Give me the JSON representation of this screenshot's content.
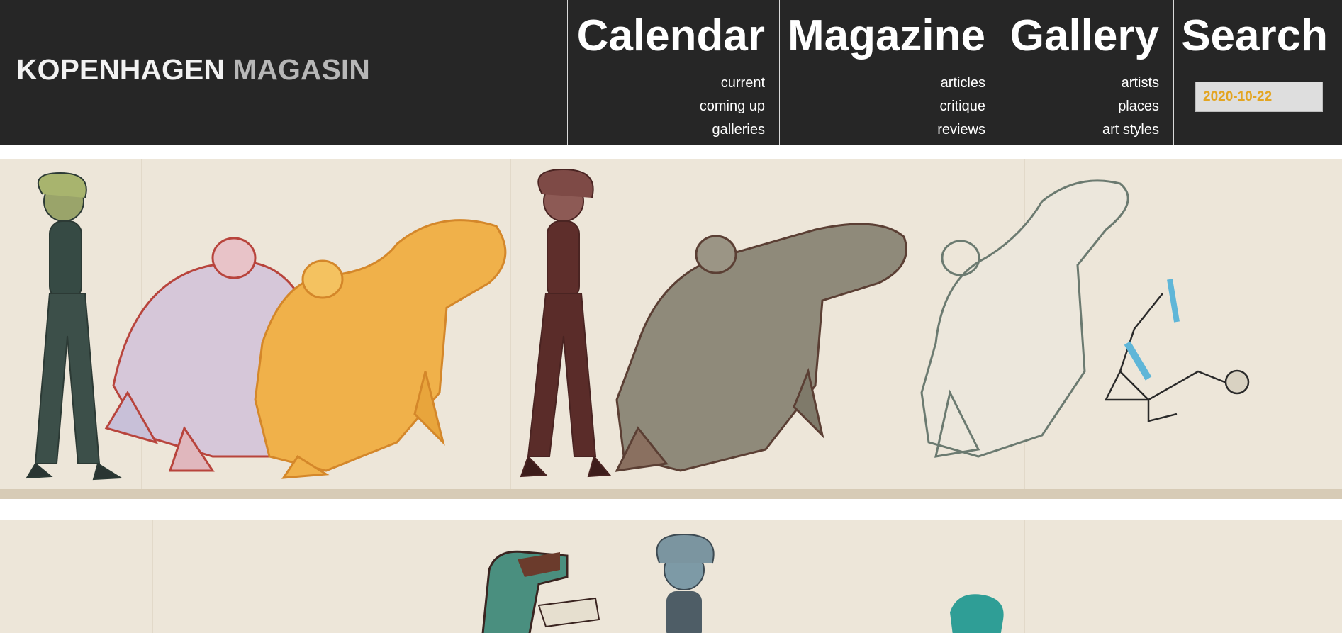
{
  "header": {
    "logo": {
      "part1": "KOPENHAGEN",
      "part2": "MAGASIN"
    },
    "nav": [
      {
        "title": "Calendar",
        "links": [
          "current",
          "coming up",
          "galleries"
        ]
      },
      {
        "title": "Magazine",
        "links": [
          "articles",
          "critique",
          "reviews"
        ]
      },
      {
        "title": "Gallery",
        "links": [
          "artists",
          "places",
          "art styles"
        ]
      }
    ],
    "search": {
      "title": "Search",
      "value": "2020-10-22"
    }
  },
  "colors": {
    "header_bg": "#262626",
    "search_value_color": "#e3a521",
    "paper": "#ede6d9"
  }
}
